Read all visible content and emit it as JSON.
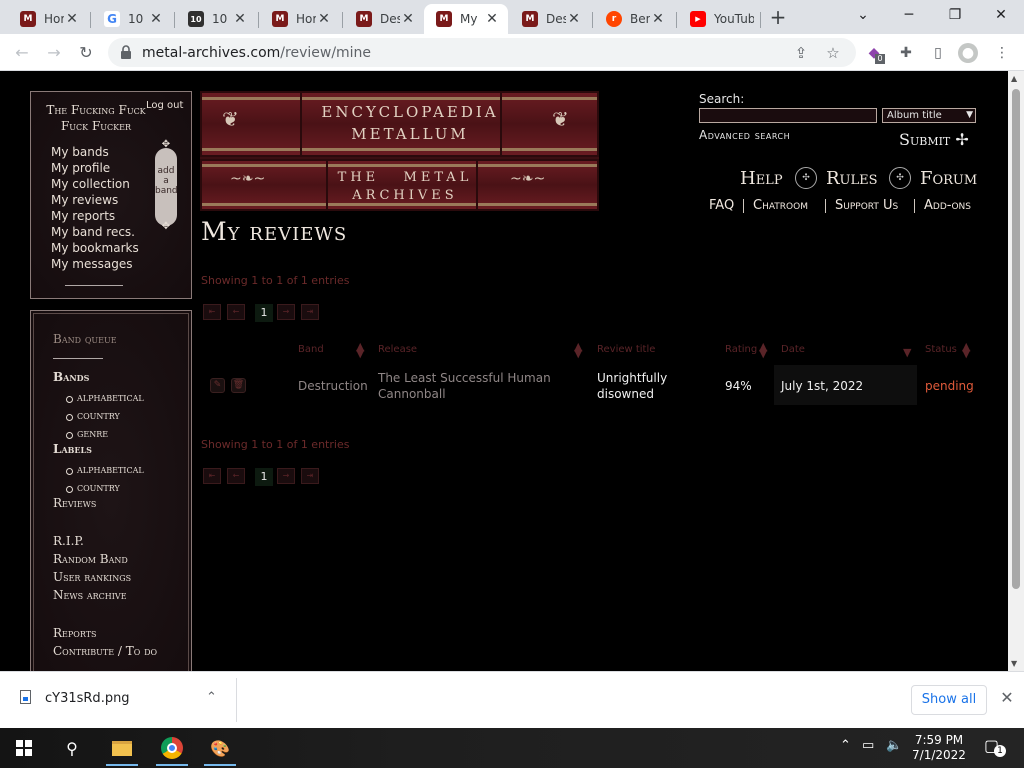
{
  "browser": {
    "tabs": [
      {
        "title": "Hor",
        "favicon": "metal-archives-icon",
        "color": "#7a1a1a",
        "glyph": "M"
      },
      {
        "title": "10",
        "favicon": "google-icon",
        "color": "#ffffff",
        "glyph": "G"
      },
      {
        "title": "10",
        "favicon": "ten-icon",
        "color": "#303030",
        "glyph": "10"
      },
      {
        "title": "Hor",
        "favicon": "metal-archives-icon",
        "color": "#7a1a1a",
        "glyph": "M"
      },
      {
        "title": "Des",
        "favicon": "metal-archives-icon",
        "color": "#7a1a1a",
        "glyph": "M"
      },
      {
        "title": "My",
        "favicon": "metal-archives-icon",
        "color": "#7a1a1a",
        "glyph": "M",
        "active": true
      },
      {
        "title": "Des",
        "favicon": "metal-archives-icon",
        "color": "#7a1a1a",
        "glyph": "M"
      },
      {
        "title": "Ben",
        "favicon": "reddit-icon",
        "color": "#ff4500",
        "glyph": "r"
      },
      {
        "title": "YouTub",
        "favicon": "youtube-icon",
        "color": "#ff0000",
        "glyph": "▶"
      }
    ],
    "url_domain": "metal-archives.com",
    "url_path": "/review/mine",
    "extension_badge": "0"
  },
  "site": {
    "user": {
      "name": "The Fucking Fuck Fuck Fucker",
      "logout": "Log out",
      "menu": [
        "My bands",
        "My profile",
        "My collection",
        "My reviews",
        "My reports",
        "My band recs.",
        "My bookmarks",
        "My messages"
      ],
      "add_band": [
        "add",
        "a",
        "band"
      ]
    },
    "sidebar": {
      "band_queue": "Band queue",
      "bands": "Bands",
      "bands_sub": [
        "alphabetical",
        "country",
        "genre"
      ],
      "labels": "Labels",
      "labels_sub": [
        "alphabetical",
        "country"
      ],
      "reviews": "Reviews",
      "rip": "R.I.P.",
      "random_band": "Random Band",
      "user_rankings": "User rankings",
      "news_archive": "News archive",
      "reports": "Reports",
      "contribute": "Contribute / To do"
    },
    "logo": {
      "line1a": "ENCYCLOPAEDIA",
      "line1b": "METALLUM",
      "line2a": "THE   METAL",
      "line2b": "ARCHIVES"
    },
    "search": {
      "label": "Search:",
      "value": "",
      "type": "Album title",
      "advanced": "Advanced search",
      "submit": "Submit"
    },
    "topnav": [
      "Help",
      "Rules",
      "Forum"
    ],
    "sublinks": [
      "FAQ",
      "Chatroom",
      "Support Us",
      "Add-ons"
    ],
    "page_title": "My reviews",
    "entries_text": "Showing 1 to 1 of 1 entries",
    "current_page": "1",
    "table": {
      "headers": [
        "Band",
        "Release",
        "Review title",
        "Rating",
        "Date",
        "Status"
      ],
      "rows": [
        {
          "band": "Destruction",
          "release": "The Least Successful Human Cannonball",
          "review_title": "Unrightfully disowned",
          "rating": "94%",
          "date": "July 1st, 2022",
          "status": "pending"
        }
      ]
    }
  },
  "download": {
    "filename": "cY31sRd.png",
    "show_all": "Show all"
  },
  "taskbar": {
    "time": "7:59 PM",
    "date": "7/1/2022",
    "notifications": "1"
  },
  "colors": {
    "accent_link": "#e05a3a",
    "muted_header": "#5a2428",
    "chrome_blue": "#1a73e8"
  }
}
